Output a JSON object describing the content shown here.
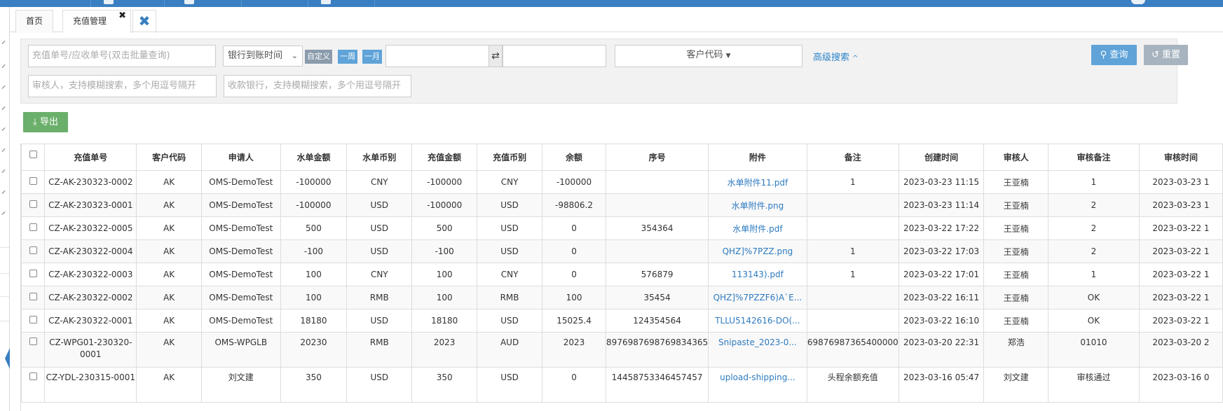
{
  "tabs": {
    "home": "首页",
    "current": "充值管理",
    "close_symbol": "✖",
    "close_all_symbol": "✖"
  },
  "filter": {
    "order_no_placeholder": "充值单号/应收单号(双击批量查询)",
    "date_type": "银行到账时间",
    "tag_custom": "自定义",
    "tag_week": "一周",
    "tag_month": "一月",
    "customer_code": "客户代码",
    "advanced": "高级搜索",
    "reviewer_placeholder": "审核人，支持模糊搜索，多个用逗号隔开",
    "bank_placeholder": "收款银行，支持模糊搜索，多个用逗号隔开",
    "query": "查询",
    "reset": "重置"
  },
  "toolbar": {
    "export": "导出"
  },
  "colors": {
    "primary": "#5fa3d8",
    "export_green": "#6aaf6a",
    "link": "#2e7bbf",
    "topbar": "#3a7fc1"
  },
  "table": {
    "columns": [
      "充值单号",
      "客户代码",
      "申请人",
      "水单金额",
      "水单币别",
      "充值金额",
      "充值币别",
      "余额",
      "序号",
      "附件",
      "备注",
      "创建时间",
      "审核人",
      "审核备注",
      "审核时间"
    ],
    "rows": [
      [
        "CZ-AK-230323-0002",
        "AK",
        "OMS-DemoTest",
        "-100000",
        "CNY",
        "-100000",
        "CNY",
        "-100000",
        "",
        "水单附件11.pdf",
        "1",
        "2023-03-23 11:15",
        "王亚楠",
        "1",
        "2023-03-23 1"
      ],
      [
        "CZ-AK-230323-0001",
        "AK",
        "OMS-DemoTest",
        "-100000",
        "USD",
        "-100000",
        "USD",
        "-98806.2",
        "",
        "水单附件.png",
        "",
        "2023-03-23 11:14",
        "王亚楠",
        "2",
        "2023-03-23 1"
      ],
      [
        "CZ-AK-230322-0005",
        "AK",
        "OMS-DemoTest",
        "500",
        "USD",
        "500",
        "USD",
        "0",
        "354364",
        "水单附件.pdf",
        "",
        "2023-03-22 17:22",
        "王亚楠",
        "2",
        "2023-03-22 1"
      ],
      [
        "CZ-AK-230322-0004",
        "AK",
        "OMS-DemoTest",
        "-100",
        "USD",
        "-100",
        "USD",
        "0",
        "",
        "QHZ]%7PZZ.png",
        "1",
        "2023-03-22 17:03",
        "王亚楠",
        "2",
        "2023-03-22 1"
      ],
      [
        "CZ-AK-230322-0003",
        "AK",
        "OMS-DemoTest",
        "100",
        "CNY",
        "100",
        "CNY",
        "0",
        "576879",
        "113143).pdf",
        "1",
        "2023-03-22 17:01",
        "王亚楠",
        "1",
        "2023-03-22 1"
      ],
      [
        "CZ-AK-230322-0002",
        "AK",
        "OMS-DemoTest",
        "100",
        "RMB",
        "100",
        "RMB",
        "100",
        "35454",
        "QHZ]%7PZZF6)A`E...",
        "",
        "2023-03-22 16:11",
        "王亚楠",
        "OK",
        "2023-03-22 1"
      ],
      [
        "CZ-AK-230322-0001",
        "AK",
        "OMS-DemoTest",
        "18180",
        "USD",
        "18180",
        "USD",
        "15025.4",
        "124354564",
        "TLLU5142616-DO(...",
        "",
        "2023-03-22 16:10",
        "王亚楠",
        "OK",
        "2023-03-22 1"
      ],
      [
        "CZ-WPG01-230320-0001",
        "AK",
        "OMS-WPGLB",
        "20230",
        "RMB",
        "2023",
        "AUD",
        "2023",
        "8976987698769834365",
        "Snipaste_2023-0...",
        "69876987365400000",
        "2023-03-20 22:31",
        "郑浩",
        "01010",
        "2023-03-20 2"
      ],
      [
        "CZ-YDL-230315-0001",
        "AK",
        "刘文建",
        "350",
        "USD",
        "350",
        "USD",
        "0",
        "14458753346457457",
        "upload-shipping...",
        "头程余额充值",
        "2023-03-16 05:47",
        "刘文建",
        "审核通过",
        "2023-03-16 0"
      ]
    ]
  }
}
